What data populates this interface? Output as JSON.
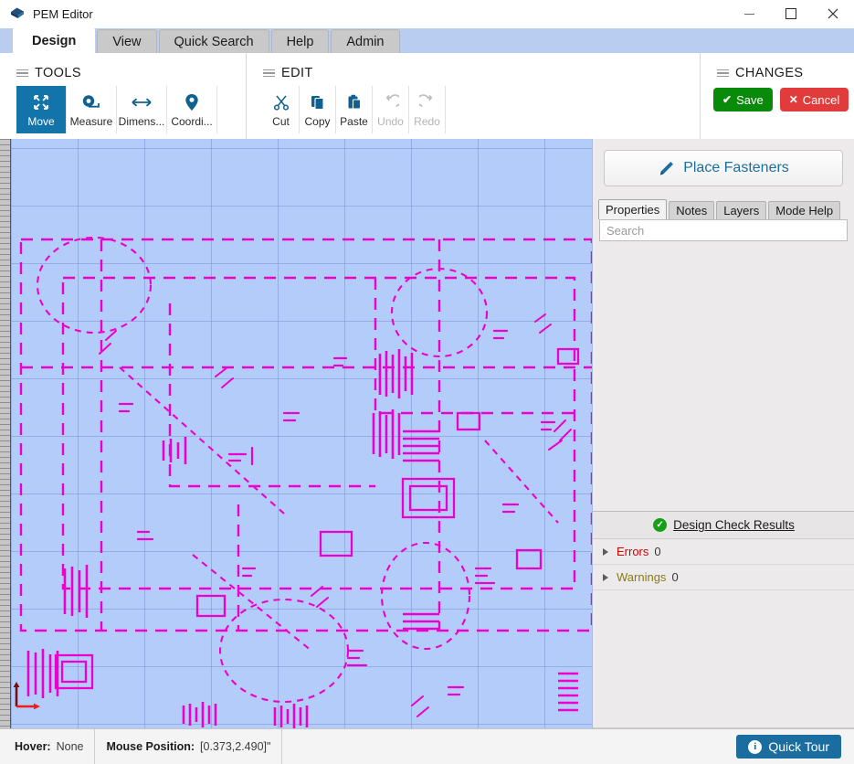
{
  "window": {
    "title": "PEM Editor",
    "app_icon": "pem-diamond-icon",
    "controls": {
      "minimize": "minimize-icon",
      "maximize": "maximize-icon",
      "close": "close-icon"
    }
  },
  "ribbon": {
    "tabs": [
      {
        "label": "Design",
        "active": true
      },
      {
        "label": "View",
        "active": false
      },
      {
        "label": "Quick Search",
        "active": false
      },
      {
        "label": "Help",
        "active": false
      },
      {
        "label": "Admin",
        "active": false
      }
    ],
    "groups": {
      "tools": {
        "title": "TOOLS",
        "buttons": [
          {
            "label": "Move",
            "icon": "move-arrows-icon",
            "active": true,
            "disabled": false
          },
          {
            "label": "Measure",
            "icon": "tape-measure-icon",
            "active": false,
            "disabled": false
          },
          {
            "label": "Dimens...",
            "icon": "dimension-arrow-icon",
            "active": false,
            "disabled": false
          },
          {
            "label": "Coordi...",
            "icon": "map-pin-icon",
            "active": false,
            "disabled": false
          }
        ]
      },
      "edit": {
        "title": "EDIT",
        "buttons": [
          {
            "label": "Cut",
            "icon": "scissors-icon",
            "disabled": false
          },
          {
            "label": "Copy",
            "icon": "copy-pages-icon",
            "disabled": false
          },
          {
            "label": "Paste",
            "icon": "clipboard-paste-icon",
            "disabled": false
          },
          {
            "label": "Undo",
            "icon": "undo-arrow-icon",
            "disabled": true
          },
          {
            "label": "Redo",
            "icon": "redo-arrow-icon",
            "disabled": true
          }
        ]
      },
      "changes": {
        "title": "CHANGES",
        "save_label": "Save",
        "save_icon": "check-icon",
        "cancel_label": "Cancel",
        "cancel_icon": "x-icon"
      }
    }
  },
  "canvas": {
    "background_color": "#b3ccfa",
    "trace_color": "#ee00cc",
    "grid_color": "#7896cd",
    "origin_icon": "origin-axes-icon"
  },
  "right_panel": {
    "place_fasteners": {
      "label": "Place Fasteners",
      "icon": "fastener-screwdriver-icon"
    },
    "tabs": [
      {
        "label": "Properties",
        "active": true
      },
      {
        "label": "Notes",
        "active": false
      },
      {
        "label": "Layers",
        "active": false
      },
      {
        "label": "Mode Help",
        "active": false
      }
    ],
    "search": {
      "value": "",
      "placeholder": "Search"
    },
    "design_check": {
      "title": "Design Check Results",
      "status_icon": "green-check-icon",
      "rows": [
        {
          "name": "Errors",
          "count": "0",
          "severity": "error"
        },
        {
          "name": "Warnings",
          "count": "0",
          "severity": "warning"
        }
      ]
    }
  },
  "status_bar": {
    "hover_label": "Hover:",
    "hover_value": "None",
    "mouse_label": "Mouse Position:",
    "mouse_value": "[0.373,2.490]\"",
    "quick_tour": {
      "label": "Quick Tour",
      "icon": "info-icon"
    }
  },
  "colors": {
    "accent_blue": "#1274a8",
    "save_green": "#0a8a0a",
    "cancel_red": "#e23b3b",
    "quick_tour_blue": "#1a6d9e",
    "error_red": "#d40000",
    "warning_olive": "#8a7a18"
  }
}
